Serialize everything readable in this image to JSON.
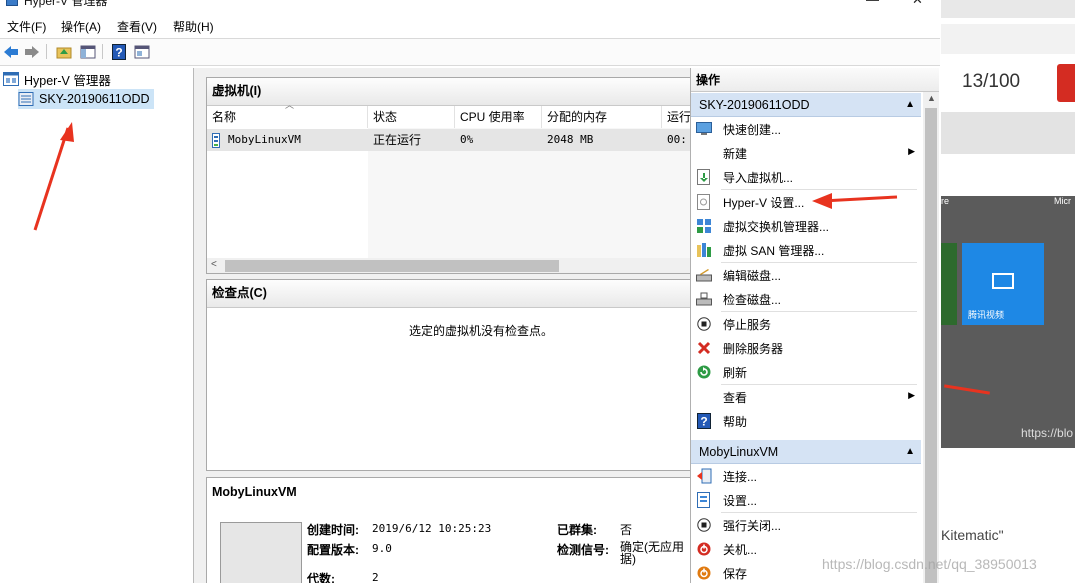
{
  "window": {
    "title": "Hyper-V 管理器",
    "minimize_glyph": "—",
    "close_glyph": "✕"
  },
  "menu": [
    "文件(F)",
    "操作(A)",
    "查看(V)",
    "帮助(H)"
  ],
  "toolbar": {
    "icons": [
      "back-arrow-icon",
      "forward-arrow-icon",
      "up-folder-icon",
      "show-hide-tree-icon",
      "help-icon",
      "properties-icon"
    ]
  },
  "tree": {
    "root": "Hyper-V 管理器",
    "server": "SKY-20190611ODD"
  },
  "vm_panel": {
    "title": "虚拟机(I)",
    "columns": [
      "名称",
      "状态",
      "CPU 使用率",
      "分配的内存",
      "运行"
    ],
    "rows": [
      {
        "name": "MobyLinuxVM",
        "state": "正在运行",
        "cpu": "0%",
        "memory": "2048 MB",
        "uptime": "00:"
      }
    ]
  },
  "checkpoint_panel": {
    "title": "检查点(C)",
    "empty_message": "选定的虚拟机没有检查点。"
  },
  "details_panel": {
    "title": "MobyLinuxVM",
    "fields": [
      {
        "label": "创建时间:",
        "value": "2019/6/12 10:25:23"
      },
      {
        "label": "配置版本:",
        "value": "9.0"
      },
      {
        "label": "代数:",
        "value": "2"
      }
    ],
    "fields_right": [
      {
        "label": "已群集:",
        "value": "否"
      },
      {
        "label": "检测信号:",
        "value": "确定(无应用\n据)"
      }
    ]
  },
  "actions": {
    "header": "操作",
    "sections": [
      {
        "title": "SKY-20190611ODD",
        "items": [
          {
            "label": "快速创建...",
            "icon": "monitor-icon"
          },
          {
            "label": "新建",
            "icon": "",
            "submenu": true
          },
          {
            "label": "导入虚拟机...",
            "icon": "import-icon"
          },
          {
            "label": "Hyper-V 设置...",
            "icon": "settings-page-icon"
          },
          {
            "label": "虚拟交换机管理器...",
            "icon": "switch-icon"
          },
          {
            "label": "虚拟 SAN 管理器...",
            "icon": "san-icon"
          },
          {
            "label": "编辑磁盘...",
            "icon": "edit-disk-icon"
          },
          {
            "label": "检查磁盘...",
            "icon": "inspect-disk-icon"
          },
          {
            "label": "停止服务",
            "icon": "stop-icon"
          },
          {
            "label": "删除服务器",
            "icon": "delete-icon"
          },
          {
            "label": "刷新",
            "icon": "refresh-icon"
          },
          {
            "label": "查看",
            "icon": "",
            "submenu": true
          },
          {
            "label": "帮助",
            "icon": "help-icon"
          }
        ]
      },
      {
        "title": "MobyLinuxVM",
        "items": [
          {
            "label": "连接...",
            "icon": "connect-icon"
          },
          {
            "label": "设置...",
            "icon": "settings-page-icon"
          },
          {
            "label": "强行关闭...",
            "icon": "turn-off-icon"
          },
          {
            "label": "关机...",
            "icon": "shutdown-icon"
          },
          {
            "label": "保存",
            "icon": "save-icon"
          }
        ]
      }
    ]
  },
  "background_page": {
    "counter": "13/100",
    "tile_labels": [
      "re",
      "Micr"
    ],
    "tile_name": "腾讯视频",
    "url_fragment": "https://blo",
    "text": "Kitematic\"",
    "watermark": "https://blog.csdn.net/qq_38950013"
  },
  "colors": {
    "selection": "#cce4f7",
    "section_header": "#d5e3f4",
    "annotation": "#e8331f",
    "tile_blue": "#1e88e5",
    "dark_bg": "#5b5b5b"
  }
}
